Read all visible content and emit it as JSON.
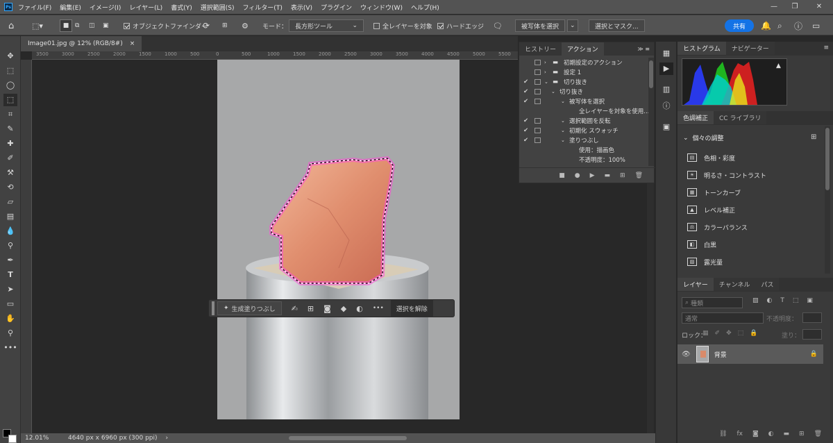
{
  "app": {
    "logo": "Ps"
  },
  "menu": [
    "ファイル(F)",
    "編集(E)",
    "イメージ(I)",
    "レイヤー(L)",
    "書式(Y)",
    "選択範囲(S)",
    "フィルター(T)",
    "表示(V)",
    "プラグイン",
    "ウィンドウ(W)",
    "ヘルプ(H)"
  ],
  "window_controls": {
    "minimize": "—",
    "restore": "❐",
    "close": "✕"
  },
  "options": {
    "object_finder": "オブジェクトファインダー",
    "mode_label": "モード：",
    "mode_value": "長方形ツール",
    "all_layers": "全レイヤーを対象",
    "hard_edge": "ハードエッジ",
    "select_subject": "被写体を選択",
    "select_mask": "選択とマスク...",
    "share": "共有"
  },
  "document": {
    "tab": "Image01.jpg @ 12% (RGB/8#)",
    "close": "×"
  },
  "ruler_top": [
    "3500",
    "3000",
    "2500",
    "2000",
    "1500",
    "1000",
    "500",
    "0",
    "500",
    "1000",
    "1500",
    "2000",
    "2500",
    "3000",
    "3500",
    "4000",
    "4500",
    "5000",
    "5500",
    "6000"
  ],
  "status": {
    "zoom": "12.01%",
    "info": "4640 px x 6960 px (300 ppi)",
    "arrow": "›"
  },
  "contextbar": {
    "generative_fill": "生成塗りつぶし",
    "more": "•••",
    "deselect": "選択を解除"
  },
  "actions_panel": {
    "tabs": [
      "ヒストリー",
      "アクション"
    ],
    "rows": [
      {
        "check": "",
        "label": "初期設定のアクション",
        "indent": 0,
        "kind": "set"
      },
      {
        "check": "",
        "label": "設定 1",
        "indent": 0,
        "kind": "set"
      },
      {
        "check": "✔",
        "label": "切り抜き",
        "indent": 0,
        "kind": "set-open"
      },
      {
        "check": "✔",
        "label": "切り抜き",
        "indent": 1,
        "kind": "action"
      },
      {
        "check": "✔",
        "label": "被写体を選択",
        "indent": 2,
        "kind": "step"
      },
      {
        "check": "",
        "label": "全レイヤーを対象を使用...",
        "indent": 3,
        "kind": "detail"
      },
      {
        "check": "✔",
        "label": "選択範囲を反転",
        "indent": 2,
        "kind": "step"
      },
      {
        "check": "✔",
        "label": "初期化 スウォッチ",
        "indent": 2,
        "kind": "step"
      },
      {
        "check": "✔",
        "label": "塗りつぶし",
        "indent": 2,
        "kind": "step"
      },
      {
        "check": "",
        "label": "使用：描画色",
        "indent": 3,
        "kind": "detail"
      },
      {
        "check": "",
        "label": "不透明度：100%",
        "indent": 3,
        "kind": "detail"
      }
    ]
  },
  "histogram_panel": {
    "tabs": [
      "ヒストグラム",
      "ナビゲーター"
    ],
    "warning": "▲"
  },
  "adjust_panel": {
    "tabs": [
      "色調補正",
      "CC ライブラリ"
    ],
    "section": "個々の調整",
    "items": [
      "色相・彩度",
      "明るさ・コントラスト",
      "トーンカーブ",
      "レベル補正",
      "カラーバランス",
      "白黒",
      "露光量"
    ]
  },
  "layers_panel": {
    "tabs": [
      "レイヤー",
      "チャンネル",
      "パス"
    ],
    "search_placeholder": "種類",
    "blend_mode": "通常",
    "opacity_label": "不透明度：",
    "lock_label": "ロック：",
    "fill_label": "塗り：",
    "layer_name": "背景"
  },
  "colors": {
    "accent": "#1473e6",
    "selection": "#ff4fd8"
  }
}
